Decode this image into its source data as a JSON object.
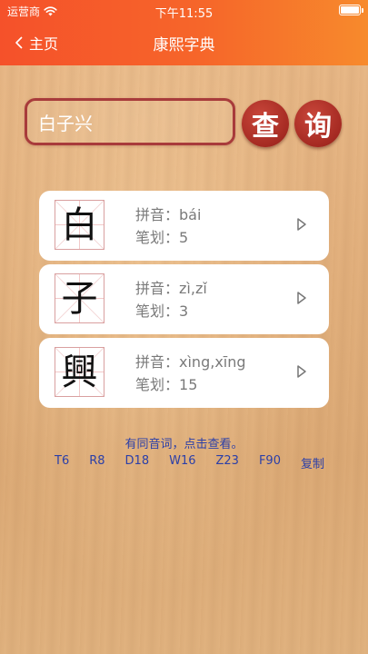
{
  "status_bar": {
    "carrier": "运营商",
    "time": "下午11:55"
  },
  "nav": {
    "back_label": "主页",
    "title": "康熙字典"
  },
  "search": {
    "value": "白子兴",
    "query_button": "查",
    "ask_button": "询"
  },
  "results": [
    {
      "char": "白",
      "pinyin_label": "拼音：",
      "pinyin": "bái",
      "strokes_label": "笔划：",
      "strokes": "5"
    },
    {
      "char": "子",
      "pinyin_label": "拼音：",
      "pinyin": "zì,zǐ",
      "strokes_label": "笔划：",
      "strokes": "3"
    },
    {
      "char": "興",
      "pinyin_label": "拼音：",
      "pinyin": "xìng,xīng",
      "strokes_label": "笔划：",
      "strokes": "15"
    }
  ],
  "hint": "有同音词，点击查看。",
  "codes": [
    "T6",
    "R8",
    "D18",
    "W16",
    "Z23",
    "F90",
    "复制"
  ],
  "colors": {
    "header_start": "#f5512a",
    "header_end": "#f78a2c",
    "button_red": "#a52a22",
    "link_blue": "#2b3fa8"
  },
  "icons": {
    "back": "chevron-left-icon",
    "wifi": "wifi-icon",
    "battery": "battery-icon",
    "play": "play-icon"
  }
}
